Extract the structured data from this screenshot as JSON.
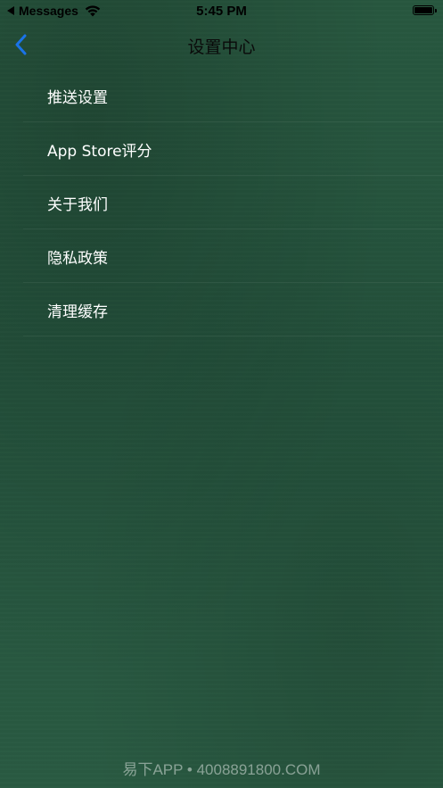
{
  "status_bar": {
    "back_app": "Messages",
    "time": "5:45 PM"
  },
  "nav": {
    "title": "设置中心",
    "back_icon": "chevron-left-icon",
    "accent_color": "#1a73e8"
  },
  "menu": {
    "items": [
      {
        "label": "推送设置"
      },
      {
        "label": "App Store评分"
      },
      {
        "label": "关于我们"
      },
      {
        "label": "隐私政策"
      },
      {
        "label": "清理缓存"
      }
    ]
  },
  "watermark": "易下APP • 4008891800.COM",
  "colors": {
    "background": "#26553e",
    "text": "#ffffff",
    "title": "#0a0a0a"
  }
}
